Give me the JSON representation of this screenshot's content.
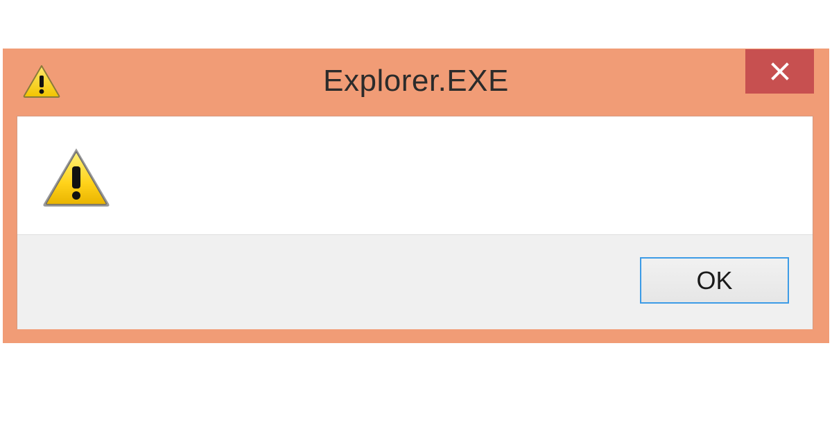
{
  "window": {
    "title": "Explorer.EXE",
    "title_icon": "warning-icon",
    "close_icon": "close-icon",
    "frame_color": "#f19c76",
    "close_color": "#c75050"
  },
  "body": {
    "icon": "warning-icon",
    "message": ""
  },
  "footer": {
    "ok_label": "OK",
    "focus_color": "#3c9be6"
  }
}
